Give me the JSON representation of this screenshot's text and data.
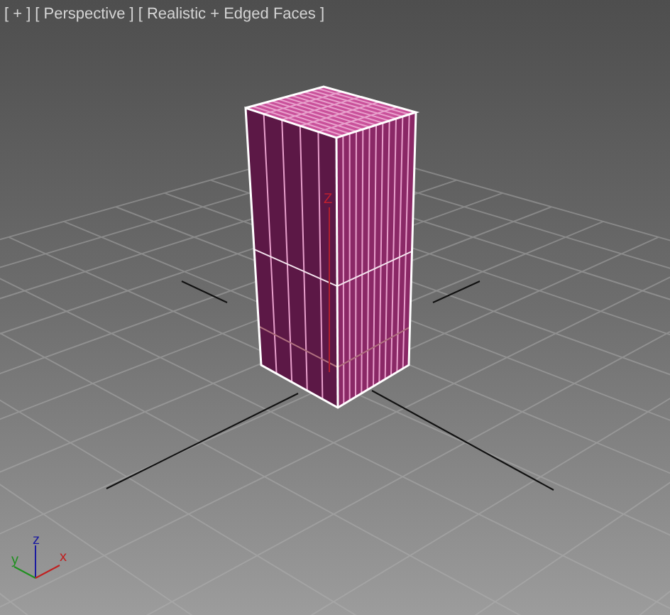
{
  "viewport_menus": [
    {
      "text": "[ + ]"
    },
    {
      "text": "[ Perspective ]"
    },
    {
      "text": "[ Realistic + Edged Faces ]"
    }
  ],
  "pivot_axis_label": "Z",
  "axis_gizmo": {
    "x_label": "x",
    "y_label": "y",
    "z_label": "z"
  }
}
